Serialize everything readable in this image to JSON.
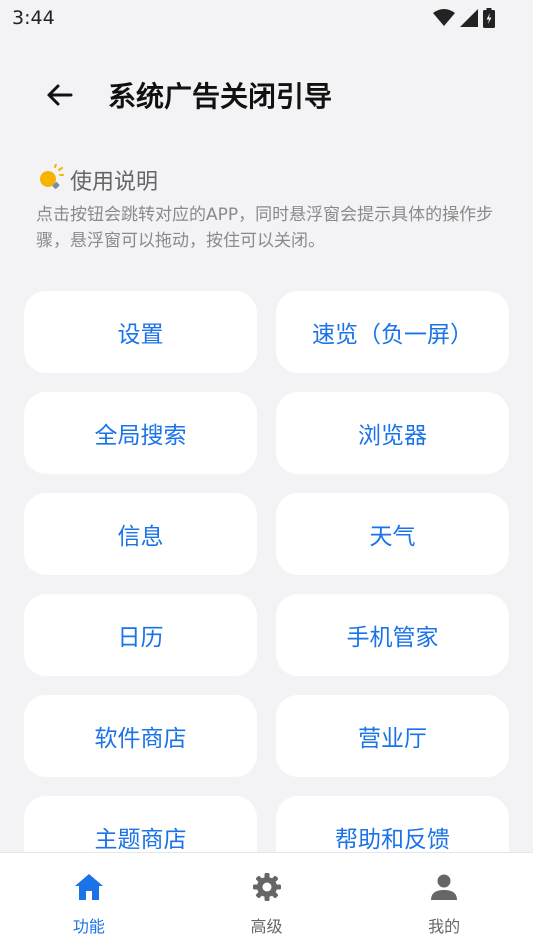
{
  "status_bar": {
    "time": "3:44"
  },
  "header": {
    "title": "系统广告关闭引导"
  },
  "instructions": {
    "title": "使用说明",
    "body": "点击按钮会跳转对应的APP，同时悬浮窗会提示具体的操作步骤，悬浮窗可以拖动，按住可以关闭。"
  },
  "buttons": [
    "设置",
    "速览（负一屏）",
    "全局搜索",
    "浏览器",
    "信息",
    "天气",
    "日历",
    "手机管家",
    "软件商店",
    "营业厅",
    "主题商店",
    "帮助和反馈"
  ],
  "bottom_nav": [
    {
      "label": "功能",
      "icon": "home-icon",
      "active": true
    },
    {
      "label": "高级",
      "icon": "gear-icon",
      "active": false
    },
    {
      "label": "我的",
      "icon": "person-icon",
      "active": false
    }
  ],
  "colors": {
    "accent": "#1a73e8",
    "background": "#f3f3f6",
    "card": "#ffffff"
  }
}
